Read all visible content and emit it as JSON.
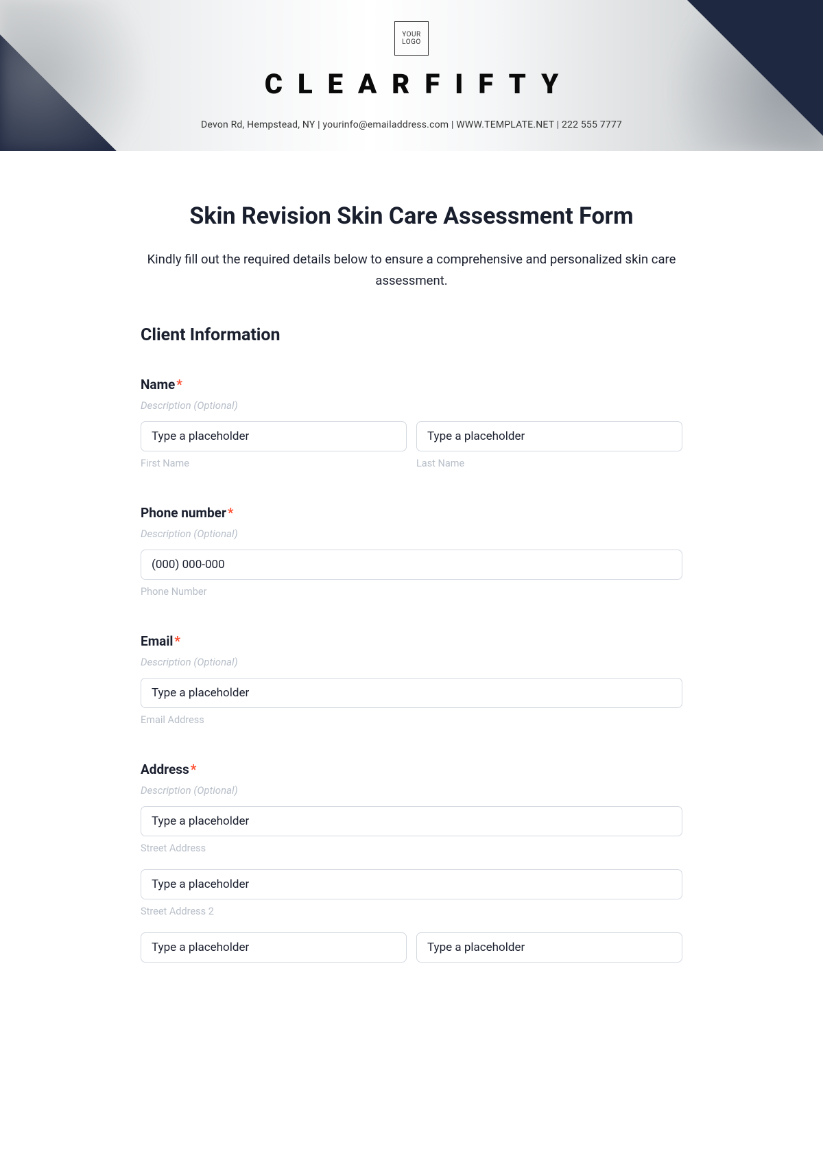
{
  "header": {
    "logo_line1": "YOUR",
    "logo_line2": "LOGO",
    "brand": "CLEARFIFTY",
    "contact": "Devon Rd, Hempstead, NY | yourinfo@emailaddress.com | WWW.TEMPLATE.NET | 222 555 7777"
  },
  "form": {
    "title": "Skin Revision Skin Care Assessment Form",
    "subtitle": "Kindly fill out the required details below to ensure a comprehensive and personalized skin care assessment.",
    "section1_title": "Client Information",
    "desc_optional": "Description (Optional)",
    "placeholder": "Type a placeholder",
    "name": {
      "label": "Name",
      "first_sublabel": "First Name",
      "last_sublabel": "Last Name"
    },
    "phone": {
      "label": "Phone number",
      "placeholder": "(000) 000-000",
      "sublabel": "Phone Number"
    },
    "email": {
      "label": "Email",
      "sublabel": "Email Address"
    },
    "address": {
      "label": "Address",
      "street1_sublabel": "Street Address",
      "street2_sublabel": "Street Address 2"
    }
  }
}
